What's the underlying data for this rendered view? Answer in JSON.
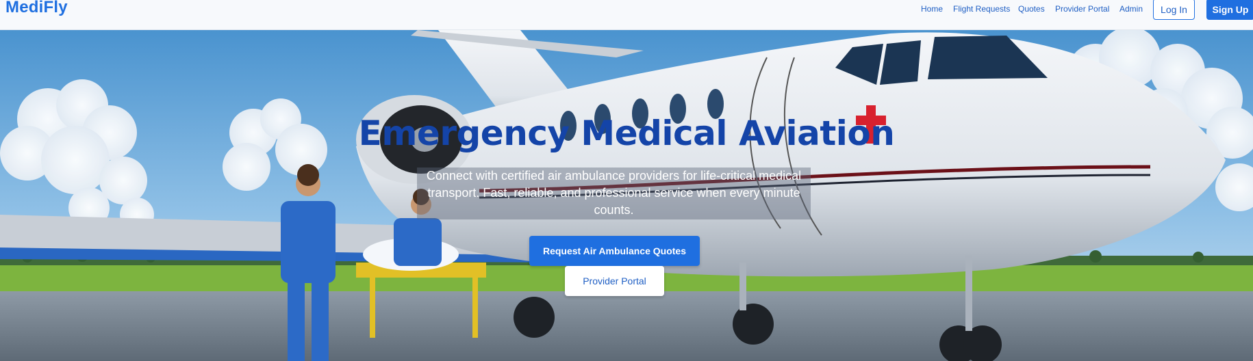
{
  "nav": {
    "brand": "MediFly",
    "links": [
      "Home",
      "Flight Requests",
      "Quotes",
      "Provider Portal",
      "Admin"
    ],
    "login_label": "Log In",
    "signup_label": "Sign Up"
  },
  "hero": {
    "headline": "Emergency Medical Aviation",
    "subtitle": "Connect with certified air ambulance providers for life-critical medical transport. Fast, reliable, and professional service when every minute counts.",
    "primary_cta": "Request Air Ambulance Quotes",
    "secondary_cta": "Provider Portal",
    "background_image": "air-ambulance-jet-with-medical-staff"
  },
  "colors": {
    "accent": "#1f6fe0",
    "headline": "#1444a8",
    "nav_bg": "#f7f9fc"
  }
}
